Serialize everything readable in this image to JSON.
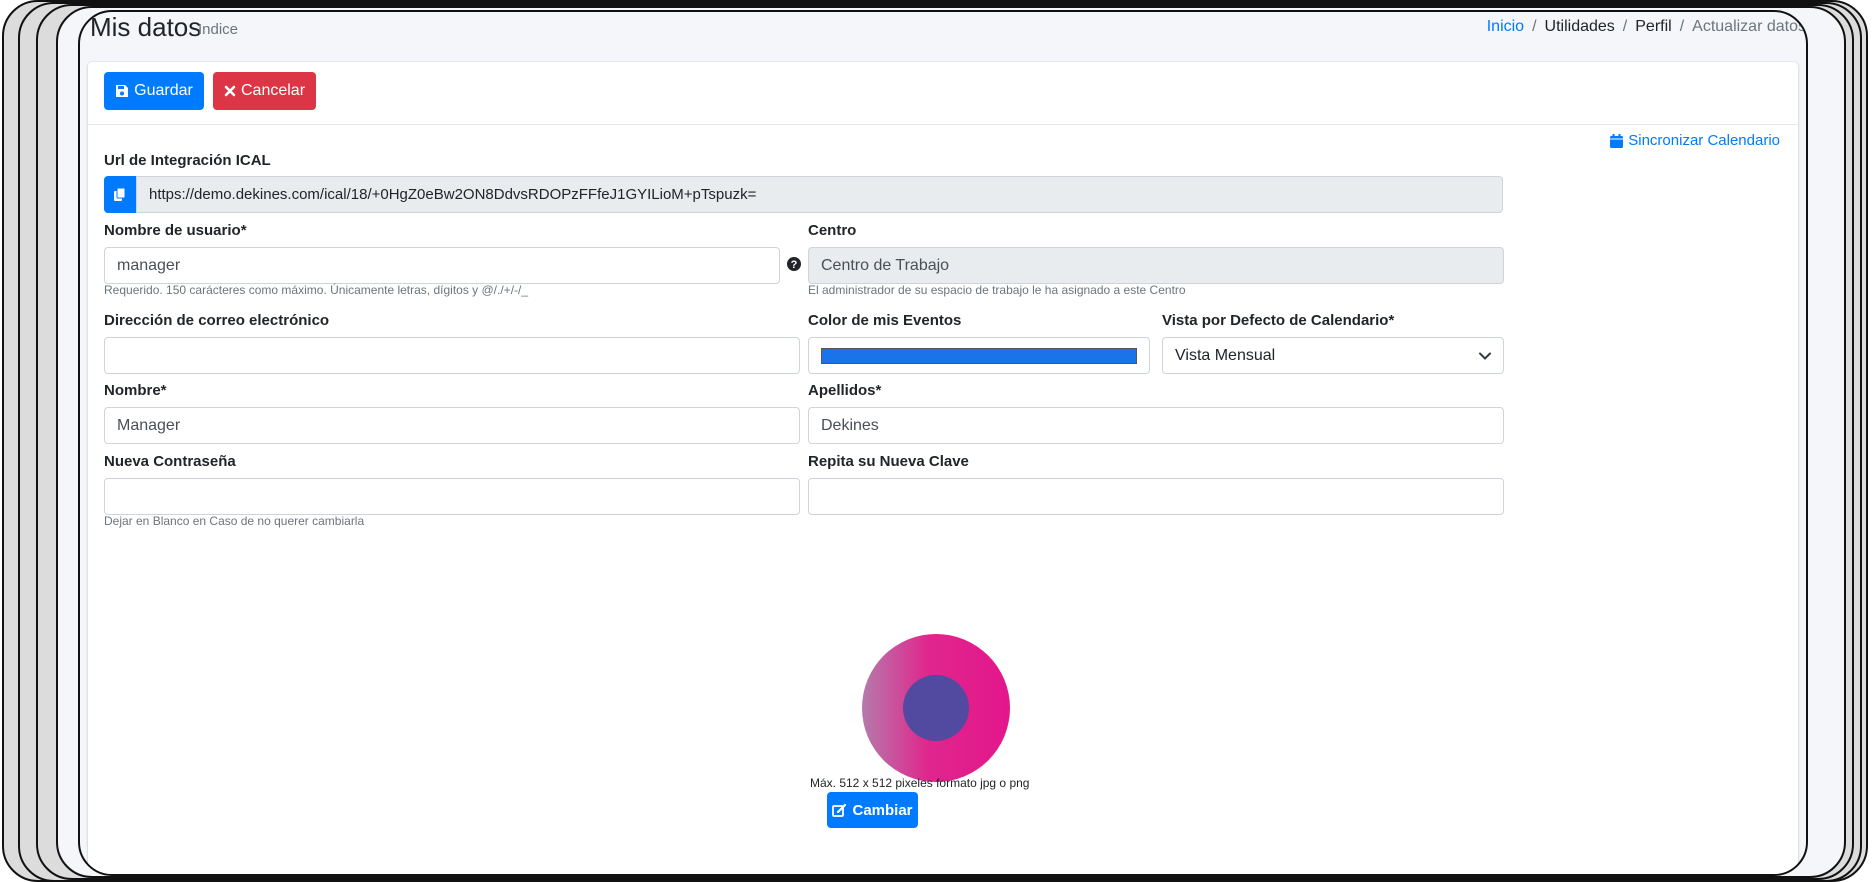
{
  "header": {
    "title": "Mis datos",
    "subtitle": "Indice",
    "breadcrumb": [
      "Inicio",
      "Utilidades",
      "Perfil",
      "Actualizar datos"
    ]
  },
  "toolbar": {
    "save_label": "Guardar",
    "cancel_label": "Cancelar"
  },
  "sync_link": "Sincronizar Calendario",
  "ical": {
    "label": "Url de Integración ICAL",
    "value": "https://demo.dekines.com/ical/18/+0HgZ0eBw2ON8DdvsRDOPzFFfeJ1GYILioM+pTspuzk="
  },
  "username": {
    "label": "Nombre de usuario*",
    "value": "manager",
    "help": "Requerido. 150 carácteres como máximo. Únicamente letras, dígitos y @/./+/-/_"
  },
  "centro": {
    "label": "Centro",
    "value": "Centro de Trabajo",
    "help": "El administrador de su espacio de trabajo le ha asignado a este Centro"
  },
  "email": {
    "label": "Dirección de correo electrónico",
    "value": ""
  },
  "event_color": {
    "label": "Color de mis Eventos",
    "color": "#1a73e8"
  },
  "calendar_view": {
    "label": "Vista por Defecto de Calendario*",
    "selected": "Vista Mensual"
  },
  "nombre": {
    "label": "Nombre*",
    "value": "Manager"
  },
  "apellidos": {
    "label": "Apellidos*",
    "value": "Dekines"
  },
  "password": {
    "label": "Nueva Contraseña",
    "help": "Dejar en Blanco en Caso de no querer cambiarla"
  },
  "password_repeat": {
    "label": "Repita su Nueva Clave"
  },
  "avatar": {
    "caption": "Máx. 512 x 512 pixeles formato jpg o png",
    "change_label": "Cambiar"
  },
  "colors": {
    "primary": "#007bff",
    "danger": "#dc3545",
    "avatar_outer": "#e3168c",
    "avatar_inner": "#524aa0"
  }
}
